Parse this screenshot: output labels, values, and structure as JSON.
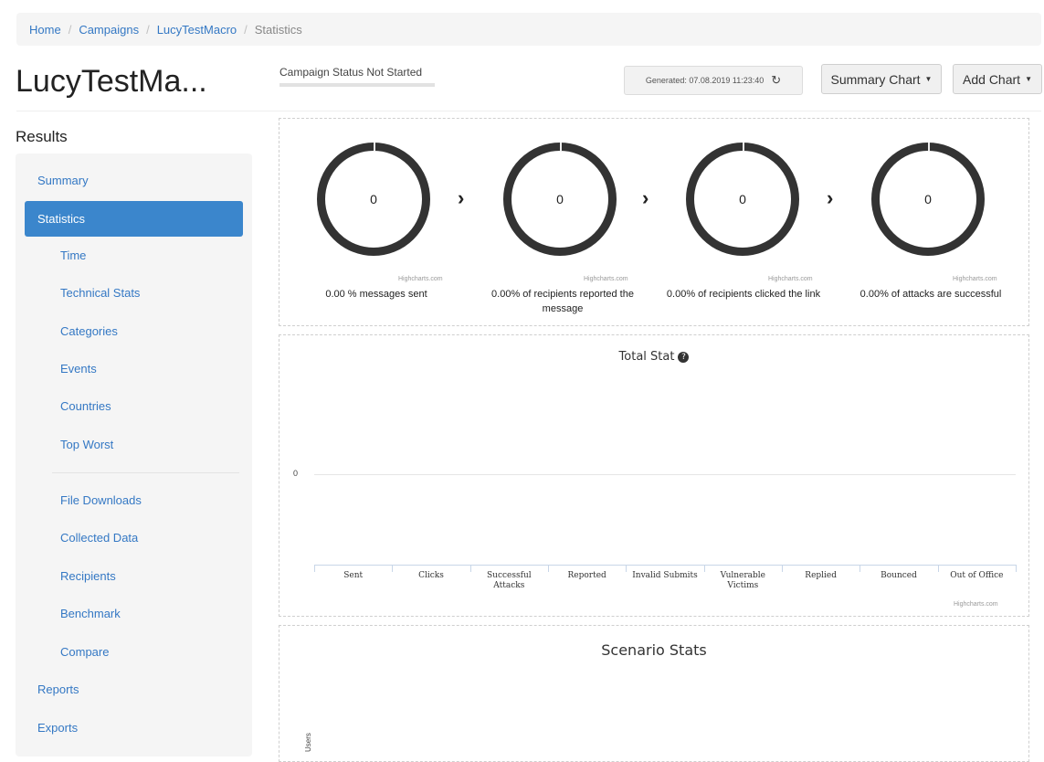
{
  "breadcrumb": {
    "items": [
      "Home",
      "Campaigns",
      "LucyTestMacro"
    ],
    "separator": "/",
    "current": "Statistics"
  },
  "page_title": "LucyTestMa...",
  "campaign_status": "Campaign Status Not Started",
  "generated": {
    "text": "Generated: 07.08.2019 11:23:40",
    "icon": "refresh-icon"
  },
  "buttons": {
    "summary_chart": "Summary Chart",
    "add_chart": "Add Chart"
  },
  "sidebar": {
    "title": "Results",
    "items": [
      {
        "label": "Summary"
      },
      {
        "label": "Statistics",
        "active": true
      },
      {
        "label": "Time"
      },
      {
        "label": "Technical Stats"
      },
      {
        "label": "Categories"
      },
      {
        "label": "Events"
      },
      {
        "label": "Countries"
      },
      {
        "label": "Top Worst"
      },
      {
        "label": "File Downloads"
      },
      {
        "label": "Collected Data"
      },
      {
        "label": "Recipients"
      },
      {
        "label": "Benchmark"
      },
      {
        "label": "Compare"
      },
      {
        "label": "Reports"
      },
      {
        "label": "Exports"
      }
    ]
  },
  "funnel": {
    "credit": "Highcharts.com",
    "stages": [
      {
        "value": "0",
        "label": "0.00 % messages sent"
      },
      {
        "value": "0",
        "label": "0.00% of recipients reported the message"
      },
      {
        "value": "0",
        "label": "0.00% of recipients clicked the link"
      },
      {
        "value": "0",
        "label": "0.00% of attacks are successful"
      }
    ]
  },
  "chart_data": [
    {
      "type": "bar",
      "title": "Total Stat",
      "categories": [
        "Sent",
        "Clicks",
        "Successful Attacks",
        "Reported",
        "Invalid Submits",
        "Vulnerable Victims",
        "Replied",
        "Bounced",
        "Out of Office"
      ],
      "values": [
        0,
        0,
        0,
        0,
        0,
        0,
        0,
        0,
        0
      ],
      "y_ticks": [
        "0"
      ],
      "credit": "Highcharts.com"
    },
    {
      "type": "bar",
      "title": "Scenario Stats",
      "ylabel": "Users"
    }
  ]
}
